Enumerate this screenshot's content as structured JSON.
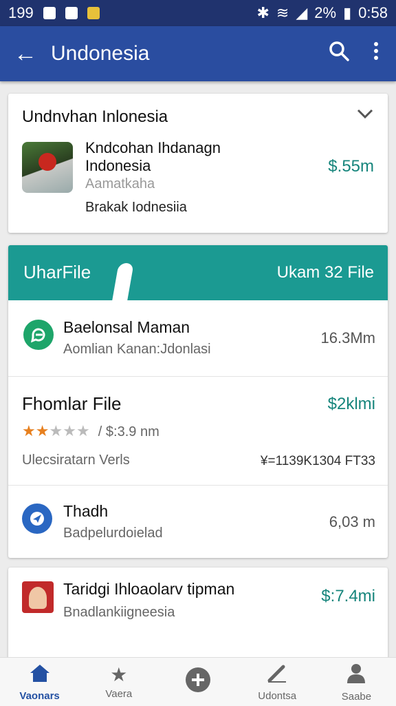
{
  "status_bar": {
    "left_time": "199",
    "battery": "2%",
    "time": "0:58"
  },
  "app_bar": {
    "title": "Undonesia",
    "icons": [
      "back-arrow-icon",
      "search-icon",
      "more-vert-icon"
    ]
  },
  "card1": {
    "title": "Undnvhan Inlonesia",
    "item": {
      "line1": "Kndcohan Ihdanagn",
      "line2": "Indonesia",
      "line3": "Aamatkaha",
      "line4": "Brakak Iodnesiia",
      "price": "$.55m"
    }
  },
  "card2": {
    "banner_left": "UharFile",
    "banner_right": "Ukam 32 File",
    "rows": [
      {
        "title": "Baelonsal Maman",
        "subtitle": "Aomlian Kanan:Jdonlasi",
        "value": "16.3Mm"
      },
      {
        "title": "Fhomlar File",
        "rating_text": "/ $:3.9 nm",
        "subtitle": "Ulecsiratarn Verls",
        "value": "$2klmi",
        "extra": "¥=1139K1304 FT33"
      },
      {
        "title": "Thadh",
        "subtitle": "Badpelurdoielad",
        "value": "6,03 m"
      }
    ],
    "rating": 2,
    "rating_max": 5
  },
  "card3": {
    "title": "Taridgi Ihloaolarv tipman",
    "subtitle": "Bnadlankiigneesia",
    "price": "$:7.4mi"
  },
  "bottom_nav": [
    {
      "label": "Vaonars",
      "icon": "home-icon",
      "active": true
    },
    {
      "label": "Vaera",
      "icon": "star-icon",
      "active": false
    },
    {
      "label": "",
      "icon": "add-circle-icon",
      "active": false
    },
    {
      "label": "Udontsa",
      "icon": "edit-icon",
      "active": false
    },
    {
      "label": "Saabe",
      "icon": "person-icon",
      "active": false
    }
  ],
  "colors": {
    "app_bar": "#2a4da0",
    "status_bar": "#20336e",
    "accent_teal": "#16857c",
    "banner": "#1b9a92",
    "star": "#e7801f"
  }
}
